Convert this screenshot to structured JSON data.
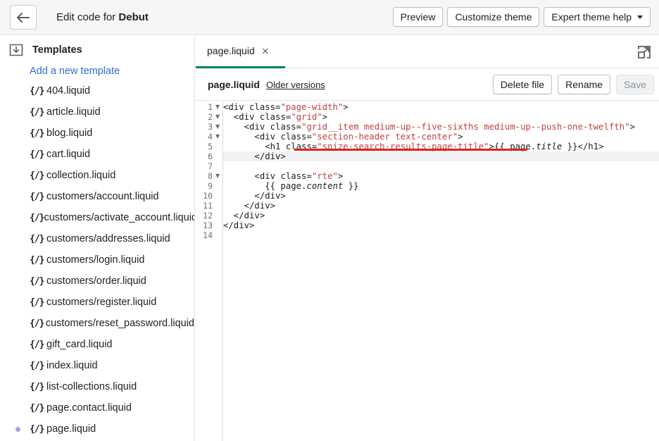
{
  "topbar": {
    "heading_prefix": "Edit code for ",
    "theme_name": "Debut",
    "preview_label": "Preview",
    "customize_label": "Customize theme",
    "expert_label": "Expert theme help"
  },
  "sidebar": {
    "section_title": "Templates",
    "add_link": "Add a new template",
    "icon_glyph": "{/}",
    "files": [
      "404.liquid",
      "article.liquid",
      "blog.liquid",
      "cart.liquid",
      "collection.liquid",
      "customers/account.liquid",
      "customers/activate_account.liquid",
      "customers/addresses.liquid",
      "customers/login.liquid",
      "customers/order.liquid",
      "customers/register.liquid",
      "customers/reset_password.liquid",
      "gift_card.liquid",
      "index.liquid",
      "list-collections.liquid",
      "page.contact.liquid",
      "page.liquid"
    ],
    "active_file": "page.liquid"
  },
  "editor": {
    "tab_label": "page.liquid",
    "tab_close": "×",
    "file_name": "page.liquid",
    "older_versions": "Older versions",
    "delete_label": "Delete file",
    "rename_label": "Rename",
    "save_label": "Save"
  },
  "code": {
    "line_numbers": [
      "1",
      "2",
      "3",
      "4",
      "5",
      "6",
      "7",
      "8",
      "9",
      "10",
      "11",
      "12",
      "13",
      "14"
    ],
    "fold_lines": [
      1,
      2,
      3,
      4,
      8
    ],
    "lines": [
      [
        [
          "t",
          "<div "
        ],
        [
          "t",
          "class="
        ],
        [
          "s",
          "\"page-width\""
        ],
        [
          "t",
          ">"
        ]
      ],
      [
        [
          "t",
          "  <div "
        ],
        [
          "t",
          "class="
        ],
        [
          "s",
          "\"grid\""
        ],
        [
          "t",
          ">"
        ]
      ],
      [
        [
          "t",
          "    <div "
        ],
        [
          "t",
          "class="
        ],
        [
          "s",
          "\"grid__item medium-up--five-sixths medium-up--push-one-twelfth\""
        ],
        [
          "t",
          ">"
        ]
      ],
      [
        [
          "t",
          "      <div "
        ],
        [
          "t",
          "class="
        ],
        [
          "s",
          "\"section-header text-center\""
        ],
        [
          "t",
          ">"
        ]
      ],
      [
        [
          "t",
          "        <h1 "
        ],
        [
          "t",
          "class="
        ],
        [
          "s",
          "\"snize-search-results-page-title\""
        ],
        [
          "t",
          ">{{ page."
        ],
        [
          "i",
          "title"
        ],
        [
          "t",
          " }}</h1>"
        ]
      ],
      [
        [
          "t",
          "      </div>"
        ]
      ],
      [
        [
          "t",
          ""
        ]
      ],
      [
        [
          "t",
          "      <div "
        ],
        [
          "t",
          "class="
        ],
        [
          "s",
          "\"rte\""
        ],
        [
          "t",
          ">"
        ]
      ],
      [
        [
          "t",
          "        {{ page."
        ],
        [
          "i",
          "content"
        ],
        [
          "t",
          " }}"
        ]
      ],
      [
        [
          "t",
          "      </div>"
        ]
      ],
      [
        [
          "t",
          "    </div>"
        ]
      ],
      [
        [
          "t",
          "  </div>"
        ]
      ],
      [
        [
          "t",
          "</div>"
        ]
      ],
      [
        [
          "t",
          ""
        ]
      ]
    ]
  },
  "colors": {
    "accent": "#008060",
    "link": "#2c6ecb",
    "string": "#c43f3f",
    "underline": "#e0201f",
    "active_dot": "#9fa5e3"
  }
}
